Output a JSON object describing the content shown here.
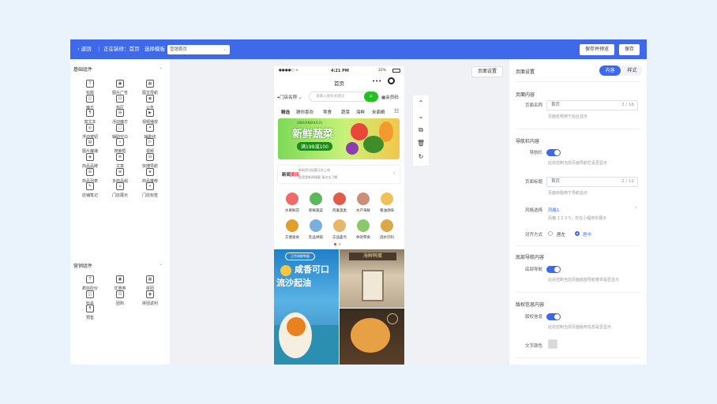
{
  "topbar": {
    "back": "返回",
    "editing_prefix": "正在装修：",
    "editing_page": "首页",
    "template_label": "选择模板",
    "template_value": "营销首页",
    "save_preview": "保存并预览",
    "save": "保存"
  },
  "left": {
    "basic_title": "基础组件",
    "basic": [
      {
        "label": "标题",
        "icon": "title-icon"
      },
      {
        "label": "图片广告",
        "icon": "image-ad-icon"
      },
      {
        "label": "图文导航",
        "icon": "image-nav-icon"
      },
      {
        "label": "魔方",
        "icon": "cube-icon"
      },
      {
        "label": "热区",
        "icon": "hotspot-icon"
      },
      {
        "label": "公告",
        "icon": "notice-icon"
      },
      {
        "label": "富文本",
        "icon": "rich-text-icon"
      },
      {
        "label": "活动魔方",
        "icon": "activity-cube-icon"
      },
      {
        "label": "视频播放",
        "icon": "video-icon"
      },
      {
        "label": "浮动按钮",
        "icon": "float-button-icon"
      },
      {
        "label": "辅助空白",
        "icon": "blank-icon"
      },
      {
        "label": "辅助线",
        "icon": "divider-line-icon"
      },
      {
        "label": "图片魔播",
        "icon": "image-carousel-icon"
      },
      {
        "label": "搜索框",
        "icon": "search-box-icon"
      },
      {
        "label": "视频",
        "icon": "video-play-icon"
      },
      {
        "label": "商品品牌",
        "icon": "brand-icon"
      },
      {
        "label": "文章",
        "icon": "article-icon"
      },
      {
        "label": "快捷导航",
        "icon": "quick-nav-icon"
      },
      {
        "label": "商品列表",
        "icon": "product-list-icon"
      },
      {
        "label": "多商品组",
        "icon": "product-group-icon"
      },
      {
        "label": "商品推荐",
        "icon": "recommend-icon"
      },
      {
        "label": "店铺笔记",
        "icon": "store-note-icon"
      },
      {
        "label": "门店展示",
        "icon": "store-display-icon"
      },
      {
        "label": "门店标签",
        "icon": "store-tag-icon"
      }
    ],
    "marketing_title": "营销组件",
    "marketing": [
      {
        "label": "疯狂砍价",
        "icon": "bargain-icon"
      },
      {
        "label": "优惠券",
        "icon": "coupon-icon"
      },
      {
        "label": "拼团",
        "icon": "group-buy-icon"
      },
      {
        "label": "秒杀",
        "icon": "flash-sale-icon"
      },
      {
        "label": "团购",
        "icon": "team-buy-icon"
      },
      {
        "label": "拼团返利",
        "icon": "rebate-icon"
      },
      {
        "label": "预售",
        "icon": "presale-icon"
      }
    ]
  },
  "phone": {
    "status_signal": "●●●●○ ≈",
    "status_time": "4:21 PM",
    "status_battery": "22%",
    "title": "首页",
    "store_name": "门店名称",
    "search_placeholder": "请输入搜索关键词",
    "member_code": "会员码",
    "tabs": [
      "精选",
      "猜你喜欢",
      "零食",
      "蔬菜",
      "海鲜",
      "米面粮"
    ],
    "banner_sub": "XINXIANSHUCAI",
    "banner_title": "新鲜蔬菜",
    "banner_price": "满198减100",
    "news_label": "新闻",
    "news_label2": "资讯",
    "news_line1": "新闻资讯标题正在上线",
    "news_line2": "这里是新闻摘要  请点击了解",
    "categories": [
      {
        "label": "水果鲜花",
        "color": "#f06a6a"
      },
      {
        "label": "新鲜蔬菜",
        "color": "#5cb85c"
      },
      {
        "label": "肉禽蛋类",
        "color": "#e25b4a"
      },
      {
        "label": "水产海鲜",
        "color": "#c98f7a"
      },
      {
        "label": "粮油调味",
        "color": "#f0c05a"
      },
      {
        "label": "方便速食",
        "color": "#e0a030"
      },
      {
        "label": "乳品烘焙",
        "color": "#7ab0e0"
      },
      {
        "label": "冻品面点",
        "color": "#e5b76a"
      },
      {
        "label": "休闲零食",
        "color": "#8ac86a"
      },
      {
        "label": "酒水饮料",
        "color": "#d9a84a"
      }
    ],
    "promo_tag": "正宗海鲜鸭蛋",
    "promo_badge": "咸香可口",
    "promo_title1": "咸香可口",
    "promo_title2": "流沙起油",
    "store_sign": "海鲜鸭蛋"
  },
  "tools": [
    "chevron-up-icon",
    "chevron-down-icon",
    "copy-icon",
    "delete-icon",
    "reset-icon"
  ],
  "canvas": {
    "page_settings_button": "页面设置"
  },
  "right": {
    "title": "页面设置",
    "tab_content": "内容",
    "tab_style": "样式",
    "section_page": "页面内容",
    "page_name_label": "页面名称",
    "page_name_value": "首页",
    "page_name_count": "2 / 16",
    "page_name_hint": "页面名称用于后台显示",
    "section_nav": "导航栏内容",
    "nav_label": "导航栏",
    "nav_hint": "此处控制当前页面导航栏是否显示",
    "page_title_label": "页面标题",
    "page_title_value": "首页",
    "page_title_count": "2 / 12",
    "page_title_hint": "页面标题用于导航显示",
    "style_label": "风格选择",
    "style_value": "风格1",
    "style_hint": "风格 1 2 3 5，仅在小程序中展示",
    "align_label": "对齐方式",
    "align_left": "居左",
    "align_center": "居中",
    "section_bottom": "底部导航内容",
    "bottom_label": "底部导航",
    "bottom_hint": "此处控制当前页面底部导航菜单是否显示",
    "section_copyright": "版权信息内容",
    "copyright_label": "版权信息",
    "copyright_hint": "此处控制当前页面版权信息是否显示",
    "text_color_label": "文字颜色",
    "accent": "#3e69e8"
  }
}
